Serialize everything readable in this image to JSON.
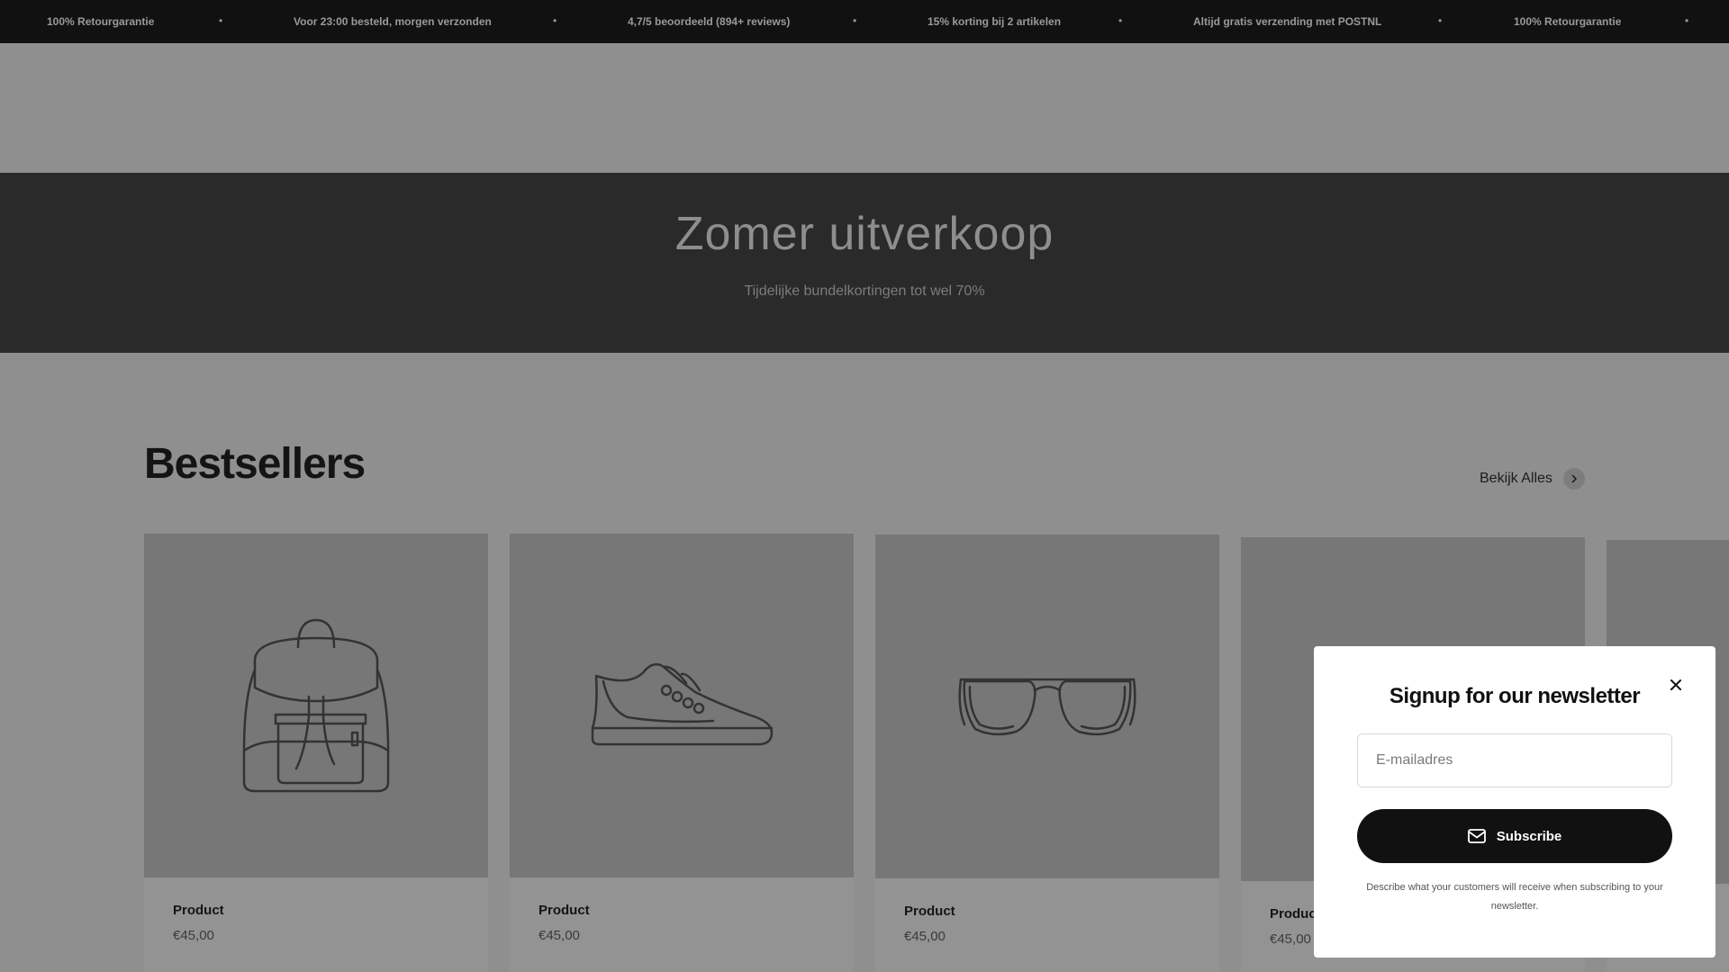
{
  "announcement": {
    "items": [
      "100% Retourgarantie",
      "Voor 23:00 besteld, morgen verzonden",
      "4,7/5 beoordeeld (894+ reviews)",
      "15% korting bij 2 artikelen",
      "Altijd gratis verzending met POSTNL",
      "100% Retourgarantie"
    ],
    "separator": "•"
  },
  "hero": {
    "title": "Zomer uitverkoop",
    "subtitle": "Tijdelijke bundelkortingen tot wel 70%"
  },
  "bestsellers": {
    "title": "Bestsellers",
    "view_all_label": "Bekijk Alles",
    "products": [
      {
        "name": "Product",
        "price": "€45,00",
        "icon": "backpack-icon"
      },
      {
        "name": "Product",
        "price": "€45,00",
        "icon": "sneaker-icon"
      },
      {
        "name": "Product",
        "price": "€45,00",
        "icon": "sunglasses-icon"
      },
      {
        "name": "Product",
        "price": "€45,00",
        "icon": ""
      }
    ]
  },
  "newsletter": {
    "title": "Signup for our newsletter",
    "email_placeholder": "E-mailadres",
    "subscribe_label": "Subscribe",
    "description": "Describe what your customers will receive when subscribing to your newsletter.",
    "close_label": "×"
  },
  "colors": {
    "overlay": "#8f8f8f",
    "announcement_bg": "#111111",
    "hero_bg": "#2a2a2a",
    "button_bg": "#111111"
  }
}
